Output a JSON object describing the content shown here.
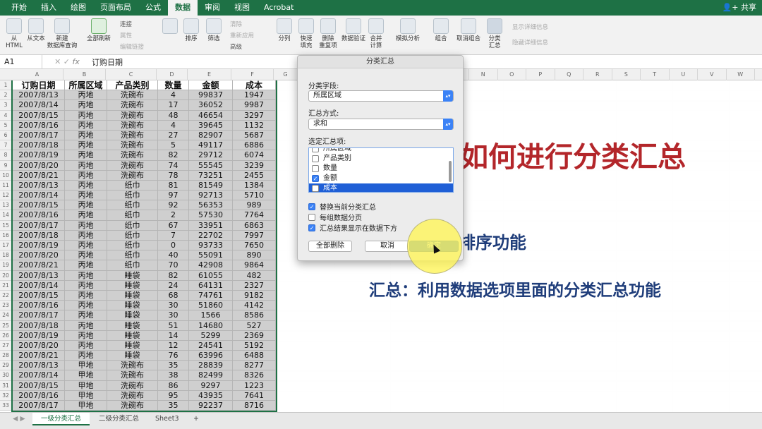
{
  "ribbon_tabs": [
    "开始",
    "插入",
    "绘图",
    "页面布局",
    "公式",
    "数据",
    "审阅",
    "视图",
    "Acrobat"
  ],
  "active_tab": "数据",
  "share_label": "共享",
  "ribbon": {
    "from_html": "从\nHTML",
    "from_text": "从文本",
    "new_db_query": "新建\n数据库查询",
    "refresh_all": "全部刷新",
    "connections": "连接",
    "properties": "属性",
    "edit_links": "编辑链接",
    "sort": "排序",
    "filter": "筛选",
    "clear": "清除",
    "reapply": "重新应用",
    "advanced": "高级",
    "text_to_columns": "分列",
    "flash_fill": "快速\n填充",
    "remove_dup": "删除\n重复项",
    "data_validation": "数据验证",
    "consolidate": "合并\n计算",
    "what_if": "模拟分析",
    "group": "组合",
    "ungroup": "取消组合",
    "subtotal": "分类\n汇总",
    "show_detail": "显示详细信息",
    "hide_detail": "隐藏详细信息"
  },
  "formula_bar": {
    "cell_ref": "A1",
    "fx": "fx",
    "content": "订购日期"
  },
  "columns": [
    "A",
    "B",
    "C",
    "D",
    "E",
    "F",
    "G",
    "H",
    "I",
    "J",
    "K",
    "L",
    "M",
    "N",
    "O",
    "P",
    "Q",
    "R",
    "S",
    "T",
    "U",
    "V",
    "W"
  ],
  "table": {
    "headers": [
      "订购日期",
      "所属区域",
      "产品类别",
      "数量",
      "金额",
      "成本"
    ],
    "rows": [
      [
        "2007/8/13",
        "丙地",
        "洗碗布",
        "4",
        "99837",
        "1947"
      ],
      [
        "2007/8/14",
        "丙地",
        "洗碗布",
        "17",
        "36052",
        "9987"
      ],
      [
        "2007/8/15",
        "丙地",
        "洗碗布",
        "48",
        "46654",
        "3297"
      ],
      [
        "2007/8/16",
        "丙地",
        "洗碗布",
        "4",
        "39645",
        "1132"
      ],
      [
        "2007/8/17",
        "丙地",
        "洗碗布",
        "27",
        "82907",
        "5687"
      ],
      [
        "2007/8/18",
        "丙地",
        "洗碗布",
        "5",
        "49117",
        "6886"
      ],
      [
        "2007/8/19",
        "丙地",
        "洗碗布",
        "82",
        "29712",
        "6074"
      ],
      [
        "2007/8/20",
        "丙地",
        "洗碗布",
        "74",
        "55545",
        "3239"
      ],
      [
        "2007/8/21",
        "丙地",
        "洗碗布",
        "78",
        "73251",
        "2455"
      ],
      [
        "2007/8/13",
        "丙地",
        "纸巾",
        "81",
        "81549",
        "1384"
      ],
      [
        "2007/8/14",
        "丙地",
        "纸巾",
        "97",
        "92713",
        "5710"
      ],
      [
        "2007/8/15",
        "丙地",
        "纸巾",
        "92",
        "56353",
        "989"
      ],
      [
        "2007/8/16",
        "丙地",
        "纸巾",
        "2",
        "57530",
        "7764"
      ],
      [
        "2007/8/17",
        "丙地",
        "纸巾",
        "67",
        "33951",
        "6863"
      ],
      [
        "2007/8/18",
        "丙地",
        "纸巾",
        "7",
        "22702",
        "7997"
      ],
      [
        "2007/8/19",
        "丙地",
        "纸巾",
        "0",
        "93733",
        "7650"
      ],
      [
        "2007/8/20",
        "丙地",
        "纸巾",
        "40",
        "55091",
        "890"
      ],
      [
        "2007/8/21",
        "丙地",
        "纸巾",
        "70",
        "42908",
        "9864"
      ],
      [
        "2007/8/13",
        "丙地",
        "睡袋",
        "82",
        "61055",
        "482"
      ],
      [
        "2007/8/14",
        "丙地",
        "睡袋",
        "24",
        "64131",
        "2327"
      ],
      [
        "2007/8/15",
        "丙地",
        "睡袋",
        "68",
        "74761",
        "9182"
      ],
      [
        "2007/8/16",
        "丙地",
        "睡袋",
        "30",
        "51860",
        "4142"
      ],
      [
        "2007/8/17",
        "丙地",
        "睡袋",
        "30",
        "1566",
        "8586"
      ],
      [
        "2007/8/18",
        "丙地",
        "睡袋",
        "51",
        "14680",
        "527"
      ],
      [
        "2007/8/19",
        "丙地",
        "睡袋",
        "14",
        "5299",
        "2369"
      ],
      [
        "2007/8/20",
        "丙地",
        "睡袋",
        "12",
        "24541",
        "5192"
      ],
      [
        "2007/8/21",
        "丙地",
        "睡袋",
        "76",
        "63996",
        "6488"
      ],
      [
        "2007/8/13",
        "甲地",
        "洗碗布",
        "35",
        "28839",
        "8277"
      ],
      [
        "2007/8/14",
        "甲地",
        "洗碗布",
        "38",
        "82499",
        "8326"
      ],
      [
        "2007/8/15",
        "甲地",
        "洗碗布",
        "86",
        "9297",
        "1223"
      ],
      [
        "2007/8/16",
        "甲地",
        "洗碗布",
        "95",
        "43935",
        "7641"
      ],
      [
        "2007/8/17",
        "甲地",
        "洗碗布",
        "35",
        "92237",
        "8716"
      ]
    ]
  },
  "dialog": {
    "title": "分类汇总",
    "field_label": "分类字段:",
    "field_value": "所属区域",
    "method_label": "汇总方式:",
    "method_value": "求和",
    "items_label": "选定汇总项:",
    "items": [
      {
        "label": "所属区域",
        "checked": false
      },
      {
        "label": "产品类别",
        "checked": false
      },
      {
        "label": "数量",
        "checked": false
      },
      {
        "label": "金额",
        "checked": true
      },
      {
        "label": "成本",
        "checked": false
      }
    ],
    "opt_replace": "替换当前分类汇总",
    "opt_pagebreak": "每组数据分页",
    "opt_below": "汇总结果显示在数据下方",
    "btn_remove_all": "全部删除",
    "btn_cancel": "取消",
    "btn_ok": "确定"
  },
  "slide": {
    "title": "如何进行分类汇总",
    "line1": "排序功能",
    "line2": "汇总：利用数据选项里面的分类汇总功能"
  },
  "sheets": [
    "一级分类汇总",
    "二级分类汇总",
    "Sheet3",
    "+"
  ]
}
